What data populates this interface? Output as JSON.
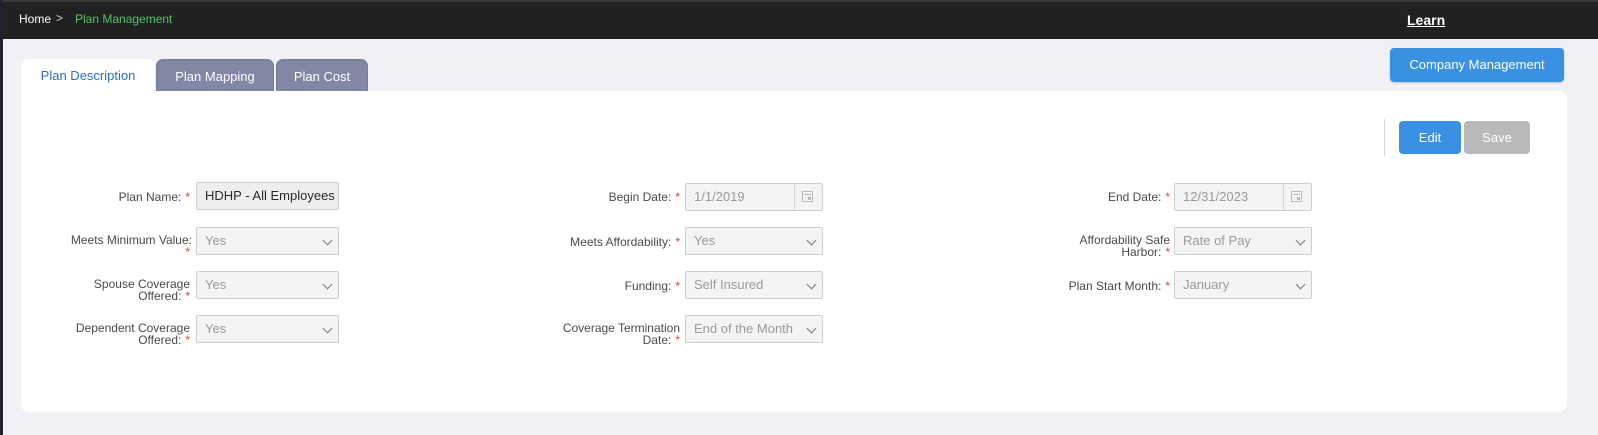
{
  "breadcrumb": {
    "home": "Home",
    "separator": ">",
    "current": "Plan Management"
  },
  "header": {
    "learn_label": "Learn"
  },
  "company_button_label": "Company Management",
  "tabs": [
    {
      "label": "Plan Description",
      "active": true
    },
    {
      "label": "Plan Mapping",
      "active": false
    },
    {
      "label": "Plan Cost",
      "active": false
    }
  ],
  "actions": {
    "edit_label": "Edit",
    "save_label": "Save"
  },
  "form": {
    "plan_name": {
      "label": "Plan Name:",
      "value": "HDHP - All Employees"
    },
    "meets_minimum_value": {
      "label_line1": "Meets Minimum Value:",
      "value": "Yes"
    },
    "spouse_coverage": {
      "label_line1": "Spouse Coverage",
      "label_line2": "Offered:",
      "value": "Yes"
    },
    "dependent_coverage": {
      "label_line1": "Dependent Coverage",
      "label_line2": "Offered:",
      "value": "Yes"
    },
    "begin_date": {
      "label": "Begin Date:",
      "value": "1/1/2019"
    },
    "meets_affordability": {
      "label": "Meets Affordability:",
      "value": "Yes"
    },
    "funding": {
      "label": "Funding:",
      "value": "Self Insured"
    },
    "coverage_termination": {
      "label_line1": "Coverage Termination",
      "label_line2": "Date:",
      "value": "End of the Month"
    },
    "end_date": {
      "label": "End Date:",
      "value": "12/31/2023"
    },
    "affordability_safe_harbor": {
      "label_line1": "Affordability Safe",
      "label_line2": "Harbor:",
      "value": "Rate of Pay"
    },
    "plan_start_month": {
      "label": "Plan Start Month:",
      "value": "January"
    },
    "required_marker": "*"
  },
  "icons": {
    "breadcrumb_separator": "chevron-right-icon",
    "date_picker": "calendar-icon",
    "select_arrow": "chevron-down-icon"
  },
  "colors": {
    "accent": "#3a91e3",
    "breadcrumb_active": "#52c26a",
    "tab_inactive": "#8287a3",
    "required": "#e23a3a"
  }
}
